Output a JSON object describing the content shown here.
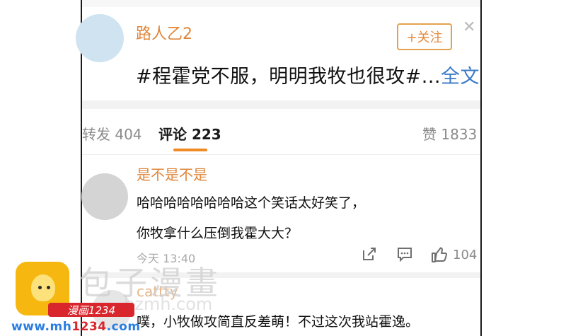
{
  "post": {
    "username": "路人乙2",
    "follow_label": "+关注",
    "close_icon": "close-icon",
    "text": "#程霍党不服，明明我牧也很攻#...",
    "more_label": "全文"
  },
  "tabs": {
    "repost": "转发 404",
    "comment": "评论 223",
    "like": "赞 1833"
  },
  "comments": [
    {
      "username": "是不是不是",
      "line1": "哈哈哈哈哈哈哈哈这个笑话太好笑了，",
      "line2": "你牧拿什么压倒我霍大大？",
      "time": "今天 13:40",
      "like_count": "104"
    },
    {
      "username": "cattty",
      "line1": "噗，小牧做攻简直反差萌！不过这次我站霍逸。"
    }
  ],
  "watermark": {
    "title": "包子漫畫",
    "sub": "bzmh.com",
    "badge": "漫画1234",
    "url_prefix": "www.mh",
    "url_red": "1234",
    "url_suffix": ".com"
  },
  "colors": {
    "accent": "#e0853a",
    "link": "#3b7ac6",
    "tab_underline": "#f08a24"
  }
}
